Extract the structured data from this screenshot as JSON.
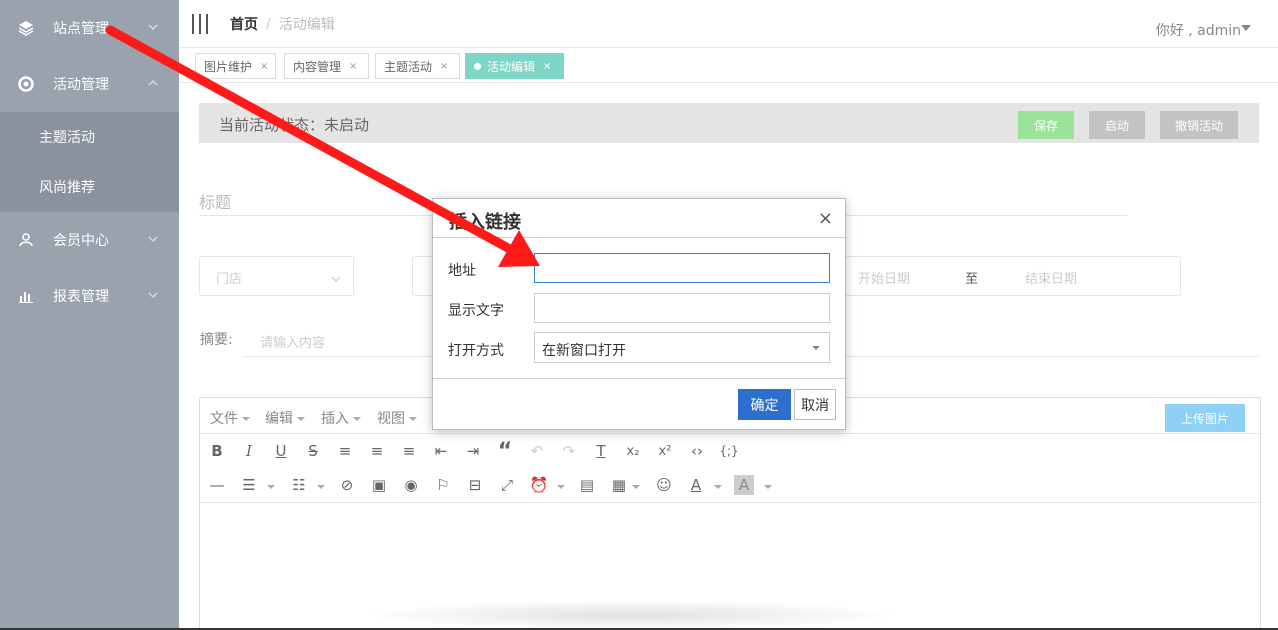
{
  "sidebar": {
    "items": [
      {
        "label": "站点管理",
        "icon": "layers-icon"
      },
      {
        "label": "活动管理",
        "icon": "lifebuoy-icon"
      },
      {
        "label": "会员中心",
        "icon": "users-icon"
      },
      {
        "label": "报表管理",
        "icon": "bar-chart-icon"
      }
    ],
    "sub_items": [
      {
        "label": "主题活动"
      },
      {
        "label": "风尚推荐"
      }
    ]
  },
  "header": {
    "breadcrumb_home": "首页",
    "breadcrumb_sep": "/",
    "breadcrumb_current": "活动编辑",
    "user_greeting": "你好 , admin"
  },
  "tabs": [
    {
      "label": "图片维护",
      "close": "×"
    },
    {
      "label": "内容管理",
      "close": "×"
    },
    {
      "label": "主题活动",
      "close": "×"
    },
    {
      "label": "活动编辑",
      "close": "×",
      "active": true
    }
  ],
  "status": {
    "text": "当前活动状态：未启动",
    "save": "保存",
    "start": "启动",
    "revoke": "撤销活动"
  },
  "form": {
    "title_label": "标题",
    "store_placeholder": "门店",
    "start_date": "开始日期",
    "to": "至",
    "end_date": "结束日期",
    "summary_label": "摘要:",
    "summary_placeholder": "请输入内容"
  },
  "editor": {
    "menus": [
      "文件",
      "编辑",
      "插入",
      "视图"
    ],
    "upload": "上传图片"
  },
  "modal": {
    "title": "插入链接",
    "close": "×",
    "url_label": "地址",
    "url_value": "",
    "text_label": "显示文字",
    "text_value": "",
    "target_label": "打开方式",
    "target_value": "在新窗口打开",
    "ok": "确定",
    "cancel": "取消"
  },
  "colors": {
    "sidebar_bg": "#9aa2ad",
    "active_tab": "#7ed6c6",
    "save_btn": "#9be39a",
    "primary": "#2d6fcf",
    "arrow": "#ff1a1a"
  }
}
